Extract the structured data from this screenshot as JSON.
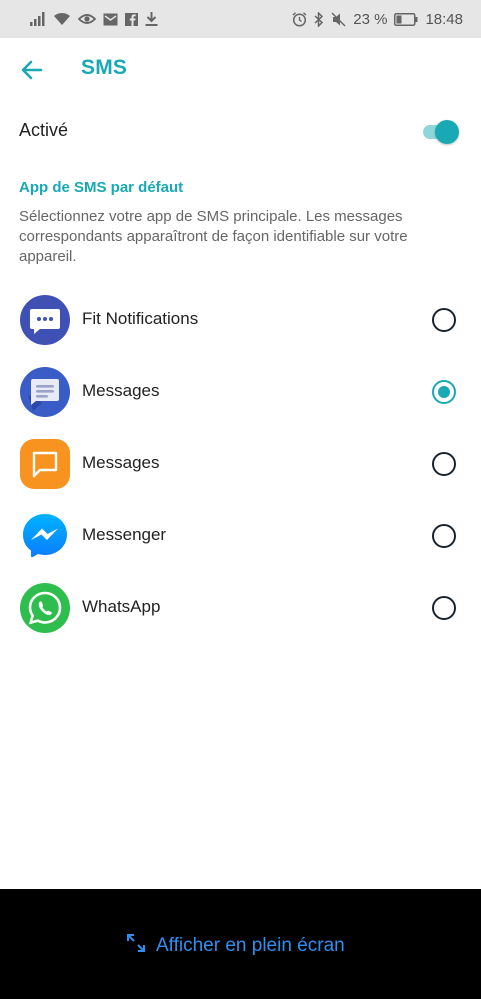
{
  "status_bar": {
    "battery_percent": "23 %",
    "time": "18:48"
  },
  "header": {
    "title": "SMS"
  },
  "toggle": {
    "label": "Activé",
    "on": true
  },
  "section": {
    "title": "App de SMS par défaut",
    "description": "Sélectionnez votre app de SMS principale. Les messages correspondants apparaîtront de façon identifiable sur votre appareil."
  },
  "apps": [
    {
      "name": "Fit Notifications",
      "icon": "fit-notifications-icon",
      "color": "#3f51b5",
      "selected": false
    },
    {
      "name": "Messages",
      "icon": "android-messages-icon",
      "color": "#3a5cc7",
      "selected": true
    },
    {
      "name": "Messages",
      "icon": "samsung-messages-icon",
      "color": "#f7931e",
      "selected": false
    },
    {
      "name": "Messenger",
      "icon": "messenger-icon",
      "color": "#1e88e5",
      "selected": false
    },
    {
      "name": "WhatsApp",
      "icon": "whatsapp-icon",
      "color": "#2fbe4d",
      "selected": false
    }
  ],
  "bottom": {
    "fullscreen_label": "Afficher en plein écran"
  },
  "colors": {
    "accent": "#18a9b5",
    "link": "#2f8ff0"
  }
}
